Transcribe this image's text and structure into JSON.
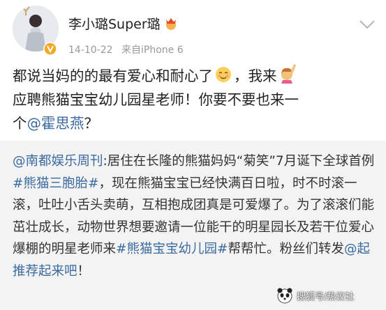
{
  "user": {
    "name": "李小璐Super璐",
    "date": "14-10-22",
    "source": "来自iPhone 6"
  },
  "post": {
    "line1_a": "都说当妈的的最有爱心和耐心了",
    "line1_b": "，我来",
    "line2": "应聘熊猫宝宝幼儿园星老师！你要不要也来一",
    "line3_a": "个",
    "mention": "@霍思燕",
    "line3_b": "？"
  },
  "repost": {
    "author": "@南都娱乐周刊",
    "text1": ":居住在长隆的熊猫妈妈“菊笑”7月诞下全球首例",
    "tag1": "#熊猫三胞胎#",
    "text2": "，现在熊猫宝宝已经快满百日啦，时不时滚一滚，吐吐小舌头卖萌，互相抱成团真是可爱爆了。为了滚滚们能茁壮成长，动物世界想要邀请一位能干的明星园长及若干位爱心爆棚的明星老师来",
    "tag2": "#熊猫宝宝幼儿园#",
    "text3": "帮帮忙。粉丝们转发",
    "mention2": "@起推荐起来吧",
    "text4": "！"
  },
  "watermark": {
    "text": "搜狐号/热议社"
  },
  "colors": {
    "link": "#3b6aa0",
    "repost_bg": "#f3f3f3",
    "verified": "#f5a623"
  }
}
